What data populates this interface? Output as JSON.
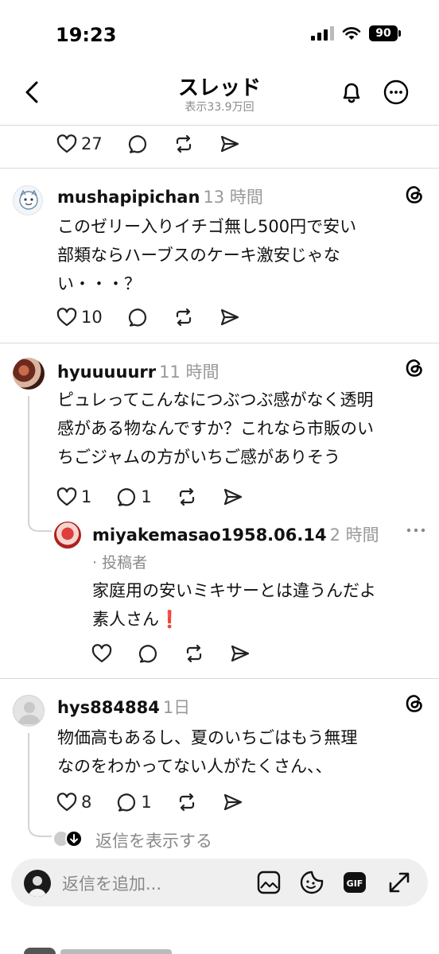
{
  "status_bar": {
    "time": "19:23",
    "battery": "90"
  },
  "header": {
    "title": "スレッド",
    "subtitle": "表示33.9万回"
  },
  "top_actions": {
    "likes": "27"
  },
  "posts": [
    {
      "username": "mushapipichan",
      "time": "13 時間",
      "lines": [
        "このゼリー入りイチゴ無し500円で安い",
        "部類ならハーブスのケーキ激安じゃな",
        "い・・・？"
      ],
      "likes": "10"
    },
    {
      "username": "hyuuuuurr",
      "time": "11 時間",
      "lines": [
        "ピュレってこんなにつぶつぶ感がなく透明",
        "感がある物なんですか？これなら市販のい",
        "ちごジャムの方がいちご感がありそう"
      ],
      "likes": "1",
      "replies": "1"
    },
    {
      "username": "miyakemasao1958.06.14",
      "time": "2 時間",
      "author_tag": "· 投稿者",
      "lines": [
        "家庭用の安いミキサーとは違うんだよ",
        "素人さん❗"
      ]
    },
    {
      "username": "hys884884",
      "time": "1日",
      "lines": [
        "物価高もあるし、夏のいちごはもう無理",
        "なのをわかってない人がたくさん、、"
      ],
      "likes": "8",
      "replies": "1"
    }
  ],
  "show_replies": "返信を表示する",
  "composer": {
    "placeholder": "返信を追加..."
  },
  "colors": {
    "accent": "#000000",
    "muted": "#999999",
    "divider": "#d9d9d9"
  }
}
